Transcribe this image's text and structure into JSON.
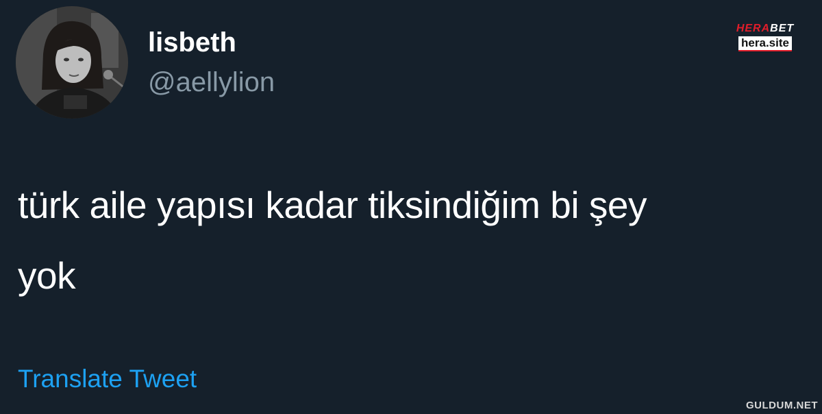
{
  "tweet": {
    "display_name": "lisbeth",
    "handle": "@aellylion",
    "text_line1": "türk aile yapısı kadar tiksindiğim bi şey",
    "text_line2": "yok",
    "translate_label": "Translate Tweet"
  },
  "watermarks": {
    "herabet_brand_a": "HERA",
    "herabet_brand_b": "BET",
    "herabet_site": "hera.site",
    "guldum": "GULDUM.NET"
  },
  "colors": {
    "background": "#15202b",
    "primary_text": "#ffffff",
    "secondary_text": "#8899a6",
    "link": "#1da1f2"
  }
}
